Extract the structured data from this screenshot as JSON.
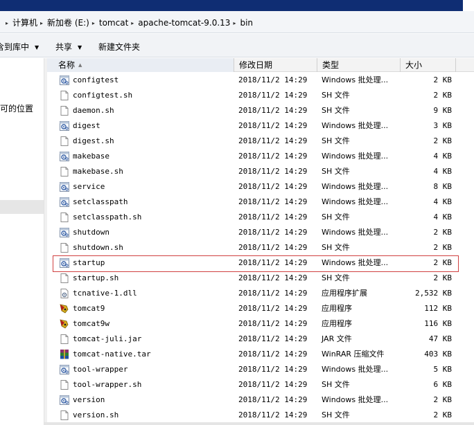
{
  "address": {
    "crumbs": [
      "计算机",
      "新加卷 (E:)",
      "tomcat",
      "apache-tomcat-9.0.13",
      "bin"
    ]
  },
  "toolbar": {
    "library_label": "含到库中",
    "share_label": "共享",
    "new_folder_label": "新建文件夹"
  },
  "nav": {
    "partial_text": "可的位置"
  },
  "columns": {
    "name": "名称",
    "date": "修改日期",
    "type": "类型",
    "size": "大小"
  },
  "files": [
    {
      "name": "configtest",
      "date": "2018/11/2 14:29",
      "type": "Windows 批处理...",
      "size": "2 KB",
      "icon": "batch-file-icon"
    },
    {
      "name": "configtest.sh",
      "date": "2018/11/2 14:29",
      "type": "SH 文件",
      "size": "2 KB",
      "icon": "blank-file-icon"
    },
    {
      "name": "daemon.sh",
      "date": "2018/11/2 14:29",
      "type": "SH 文件",
      "size": "9 KB",
      "icon": "blank-file-icon"
    },
    {
      "name": "digest",
      "date": "2018/11/2 14:29",
      "type": "Windows 批处理...",
      "size": "3 KB",
      "icon": "batch-file-icon"
    },
    {
      "name": "digest.sh",
      "date": "2018/11/2 14:29",
      "type": "SH 文件",
      "size": "2 KB",
      "icon": "blank-file-icon"
    },
    {
      "name": "makebase",
      "date": "2018/11/2 14:29",
      "type": "Windows 批处理...",
      "size": "4 KB",
      "icon": "batch-file-icon"
    },
    {
      "name": "makebase.sh",
      "date": "2018/11/2 14:29",
      "type": "SH 文件",
      "size": "4 KB",
      "icon": "blank-file-icon"
    },
    {
      "name": "service",
      "date": "2018/11/2 14:29",
      "type": "Windows 批处理...",
      "size": "8 KB",
      "icon": "batch-file-icon"
    },
    {
      "name": "setclasspath",
      "date": "2018/11/2 14:29",
      "type": "Windows 批处理...",
      "size": "4 KB",
      "icon": "batch-file-icon"
    },
    {
      "name": "setclasspath.sh",
      "date": "2018/11/2 14:29",
      "type": "SH 文件",
      "size": "4 KB",
      "icon": "blank-file-icon"
    },
    {
      "name": "shutdown",
      "date": "2018/11/2 14:29",
      "type": "Windows 批处理...",
      "size": "2 KB",
      "icon": "batch-file-icon"
    },
    {
      "name": "shutdown.sh",
      "date": "2018/11/2 14:29",
      "type": "SH 文件",
      "size": "2 KB",
      "icon": "blank-file-icon"
    },
    {
      "name": "startup",
      "date": "2018/11/2 14:29",
      "type": "Windows 批处理...",
      "size": "2 KB",
      "icon": "batch-file-icon"
    },
    {
      "name": "startup.sh",
      "date": "2018/11/2 14:29",
      "type": "SH 文件",
      "size": "2 KB",
      "icon": "blank-file-icon"
    },
    {
      "name": "tcnative-1.dll",
      "date": "2018/11/2 14:29",
      "type": "应用程序扩展",
      "size": "2,532 KB",
      "icon": "dll-file-icon"
    },
    {
      "name": "tomcat9",
      "date": "2018/11/2 14:29",
      "type": "应用程序",
      "size": "112 KB",
      "icon": "tomcat-exe-icon"
    },
    {
      "name": "tomcat9w",
      "date": "2018/11/2 14:29",
      "type": "应用程序",
      "size": "116 KB",
      "icon": "tomcat-exe-icon"
    },
    {
      "name": "tomcat-juli.jar",
      "date": "2018/11/2 14:29",
      "type": "JAR 文件",
      "size": "47 KB",
      "icon": "blank-file-icon"
    },
    {
      "name": "tomcat-native.tar",
      "date": "2018/11/2 14:29",
      "type": "WinRAR 压缩文件",
      "size": "403 KB",
      "icon": "winrar-archive-icon"
    },
    {
      "name": "tool-wrapper",
      "date": "2018/11/2 14:29",
      "type": "Windows 批处理...",
      "size": "5 KB",
      "icon": "batch-file-icon"
    },
    {
      "name": "tool-wrapper.sh",
      "date": "2018/11/2 14:29",
      "type": "SH 文件",
      "size": "6 KB",
      "icon": "blank-file-icon"
    },
    {
      "name": "version",
      "date": "2018/11/2 14:29",
      "type": "Windows 批处理...",
      "size": "2 KB",
      "icon": "batch-file-icon"
    },
    {
      "name": "version.sh",
      "date": "2018/11/2 14:29",
      "type": "SH 文件",
      "size": "2 KB",
      "icon": "blank-file-icon"
    }
  ],
  "highlighted_file": "startup",
  "colors": {
    "title_bar": "#0f2d73",
    "highlight_border": "#d04040"
  }
}
